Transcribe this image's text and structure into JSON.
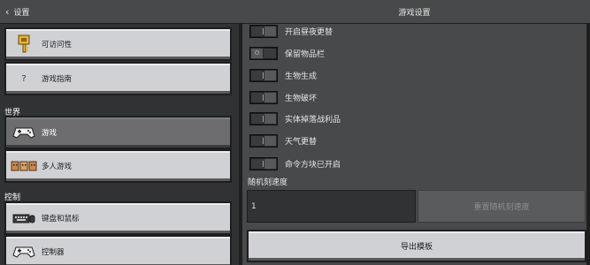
{
  "header": {
    "back_label": "设置",
    "title": "游戏设置"
  },
  "sidebar": {
    "items": [
      {
        "label": "可访问性",
        "icon": "key-icon"
      },
      {
        "label": "游戏指南",
        "icon": "question-icon",
        "glyph": "?"
      },
      {
        "label": "游戏",
        "icon": "gamepad-icon"
      },
      {
        "label": "多人游戏",
        "icon": "multiplayer-icon"
      },
      {
        "label": "键盘和鼠标",
        "icon": "keyboard-icon"
      },
      {
        "label": "控制器",
        "icon": "controller-icon"
      }
    ],
    "sections": {
      "world": "世界",
      "controls": "控制"
    },
    "selected": "游戏"
  },
  "settings": {
    "toggles": [
      {
        "label": "开启昼夜更替",
        "state": "on"
      },
      {
        "label": "保留物品栏",
        "state": "off"
      },
      {
        "label": "生物生成",
        "state": "on"
      },
      {
        "label": "生物破坏",
        "state": "on"
      },
      {
        "label": "实体掉落战利品",
        "state": "on"
      },
      {
        "label": "天气更替",
        "state": "on"
      },
      {
        "label": "命令方块已开启",
        "state": "on"
      }
    ],
    "seed_label": "随机刻速度",
    "seed_value": "1",
    "reset_label": "重置随机刻速度",
    "export_label": "导出模板"
  },
  "colors": {
    "background": "#313233",
    "panel": "#48494a",
    "button": "#d0d1d4",
    "selected": "#6d6d6f"
  }
}
